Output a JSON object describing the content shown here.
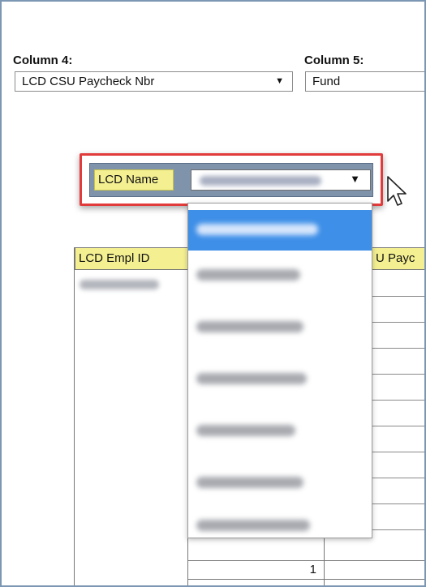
{
  "columns": {
    "col4": {
      "label": "Column 4:",
      "selected": "LCD CSU Paycheck Nbr"
    },
    "col5": {
      "label": "Column 5:",
      "selected": "Fund"
    }
  },
  "filter": {
    "label": "LCD Name",
    "dropdown_items_count": 7,
    "selected_index": 0
  },
  "table": {
    "headers": [
      "LCD Empl ID",
      "",
      "U Payc"
    ],
    "footer_count": "1"
  },
  "icons": {
    "dropdown_arrow": "chevron-down-icon",
    "cursor": "mouse-pointer-icon"
  },
  "colors": {
    "highlight_border": "#e23b3b",
    "header_bg": "#f4f092",
    "selection_bg": "#3e8fe8"
  }
}
